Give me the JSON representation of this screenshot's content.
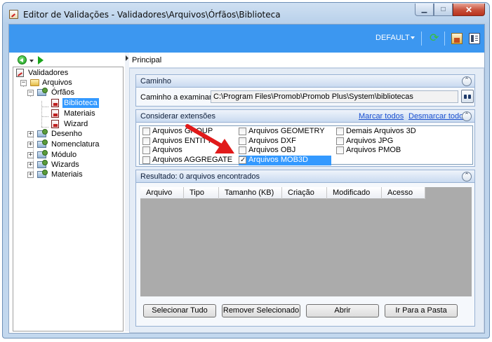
{
  "window": {
    "title": "Editor de Validações - Validadores\\Arquivos\\Órfãos\\Biblioteca",
    "min_glyph": "▁",
    "max_glyph": "□",
    "close_glyph": "✕"
  },
  "toolbar": {
    "profile_label": "DEFAULT"
  },
  "tree": {
    "items": [
      {
        "label": "Validadores"
      },
      {
        "label": "Arquivos"
      },
      {
        "label": "Órfãos"
      },
      {
        "label": "Biblioteca"
      },
      {
        "label": "Materiais"
      },
      {
        "label": "Wizard"
      },
      {
        "label": "Desenho"
      },
      {
        "label": "Nomenclatura"
      },
      {
        "label": "Módulo"
      },
      {
        "label": "Wizards"
      },
      {
        "label": "Materiais"
      }
    ],
    "expander_plus": "+",
    "expander_minus": "−"
  },
  "main": {
    "tab_label": "Principal",
    "path_section": {
      "title": "Caminho",
      "label": "Caminho a examinar",
      "value": "C:\\Program Files\\Promob\\Promob Plus\\System\\bibliotecas"
    },
    "ext_section": {
      "title": "Considerar extensões",
      "select_all": "Marcar todos",
      "deselect_all": "Desmarcar todos",
      "items": [
        {
          "label": "Arquivos GROUP",
          "checked": false
        },
        {
          "label": "Arquivos ENTITY",
          "checked": false
        },
        {
          "label": "Arquivos",
          "checked": false
        },
        {
          "label": "Arquivos AGGREGATE",
          "checked": false
        },
        {
          "label": "Arquivos GEOMETRY",
          "checked": false
        },
        {
          "label": "Arquivos DXF",
          "checked": false
        },
        {
          "label": "Arquivos OBJ",
          "checked": false
        },
        {
          "label": "Arquivos MOB3D",
          "checked": true
        },
        {
          "label": "Demais Arquivos 3D",
          "checked": false
        },
        {
          "label": "Arquivos JPG",
          "checked": false
        },
        {
          "label": "Arquivos PMOB",
          "checked": false
        }
      ]
    },
    "results_section": {
      "title": "Resultado: 0 arquivos encontrados",
      "columns": [
        "Arquivo",
        "Tipo",
        "Tamanho (KB)",
        "Criação",
        "Modificado",
        "Acesso"
      ]
    },
    "collapse_glyph": "⌃",
    "buttons": {
      "select_all": "Selecionar Tudo",
      "remove_selected": "Remover Selecionado",
      "open": "Abrir",
      "go_to_folder": "Ir Para a Pasta"
    }
  },
  "colors": {
    "toolbar_blue": "#3c97f0",
    "selection_blue": "#3399ff",
    "annotation_red": "#e11a1a"
  }
}
